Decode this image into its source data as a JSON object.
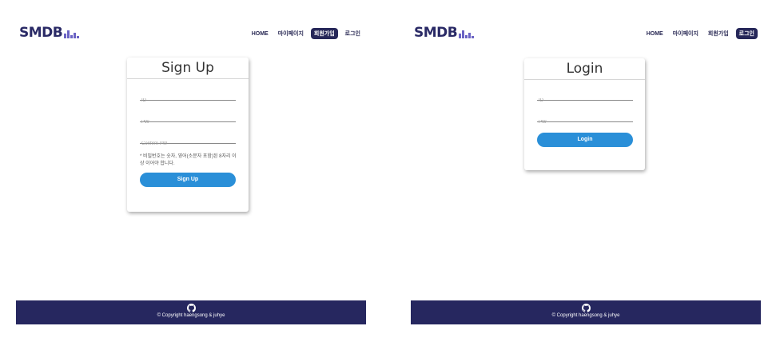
{
  "brand": {
    "logo_text": "SMDB",
    "accent": "#26275f",
    "button_color": "#2a8fd8"
  },
  "nav": {
    "home": "HOME",
    "mypage": "마이페이지",
    "signup": "회원가입",
    "login": "로그인"
  },
  "signup": {
    "title": "Sign Up",
    "id_placeholder": "ID",
    "pw_placeholder": "PW",
    "confirm_placeholder": "Confirm PW",
    "note": "* 비밀번호는 숫자, 영어(소문자 포함)된 8자리 이상 이어야 합니다.",
    "button": "Sign Up"
  },
  "login": {
    "title": "Login",
    "id_placeholder": "ID",
    "pw_placeholder": "PW",
    "button": "Login"
  },
  "footer": {
    "icon": "github-icon",
    "copyright": "© Copyright haengsong & juhye"
  }
}
